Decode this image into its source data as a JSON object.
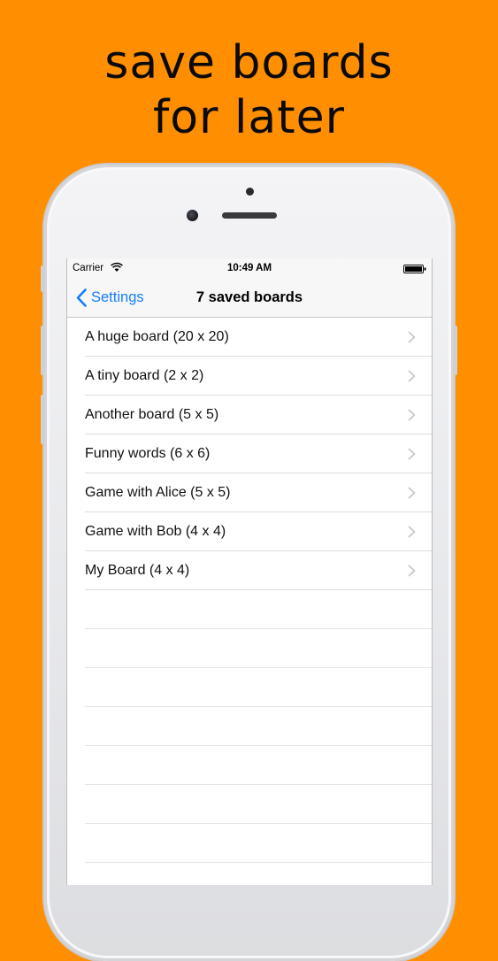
{
  "promo": {
    "line1": "save boards",
    "line2": "for later"
  },
  "status_bar": {
    "carrier": "Carrier",
    "time": "10:49 AM"
  },
  "nav": {
    "back_label": "Settings",
    "title": "7 saved boards"
  },
  "boards": [
    {
      "label": "A huge board (20 x 20)"
    },
    {
      "label": "A tiny board (2 x 2)"
    },
    {
      "label": "Another board (5 x 5)"
    },
    {
      "label": "Funny words (6 x 6)"
    },
    {
      "label": "Game with Alice (5 x 5)"
    },
    {
      "label": "Game with Bob (4 x 4)"
    },
    {
      "label": "My Board (4 x 4)"
    }
  ],
  "colors": {
    "background": "#FF8E00",
    "accent": "#147EFB"
  },
  "icons": {
    "back": "chevron-left-icon",
    "row": "chevron-right-icon",
    "wifi": "wifi-icon",
    "battery": "battery-icon"
  }
}
